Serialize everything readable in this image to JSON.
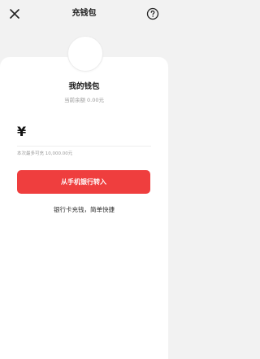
{
  "header": {
    "title": "充钱包",
    "close_icon": "close-icon",
    "help_icon": "question-circle-icon"
  },
  "wallet": {
    "title": "我的钱包",
    "balance_text": "当前余额 0.00元"
  },
  "amount": {
    "currency_symbol": "¥",
    "value": ""
  },
  "limit_text": "本次最多可充 10,000.00元",
  "transfer_button_label": "从手机银行转入",
  "subtitle": "银行卡充钱，简单快捷",
  "colors": {
    "accent": "#ef3e3e",
    "background": "#f2f2f2",
    "card": "#ffffff"
  }
}
